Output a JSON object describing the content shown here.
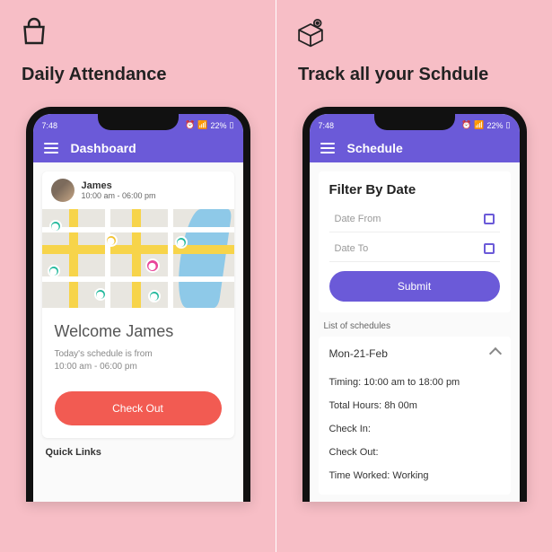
{
  "left": {
    "feature_title": "Daily Attendance",
    "statusbar": {
      "time": "7:48",
      "battery": "22%"
    },
    "appbar": {
      "title": "Dashboard"
    },
    "user": {
      "name": "James",
      "time_range": "10:00 am - 06:00 pm"
    },
    "welcome": {
      "title": "Welcome James",
      "line1": "Today's schedule is from",
      "line2": "10:00 am - 06:00 pm"
    },
    "checkout_label": "Check Out",
    "quick_links_label": "Quick Links"
  },
  "right": {
    "feature_title": "Track all your Schdule",
    "statusbar": {
      "time": "7:48",
      "battery": "22%"
    },
    "appbar": {
      "title": "Schedule"
    },
    "filter": {
      "title": "Filter By Date",
      "date_from_placeholder": "Date From",
      "date_to_placeholder": "Date To",
      "submit_label": "Submit"
    },
    "list_label": "List of schedules",
    "schedule": {
      "date": "Mon-21-Feb",
      "timing": "Timing: 10:00 am to 18:00 pm",
      "total_hours": "Total Hours: 8h 00m",
      "check_in": "Check In:",
      "check_out": "Check Out:",
      "time_worked": "Time Worked: Working"
    }
  }
}
